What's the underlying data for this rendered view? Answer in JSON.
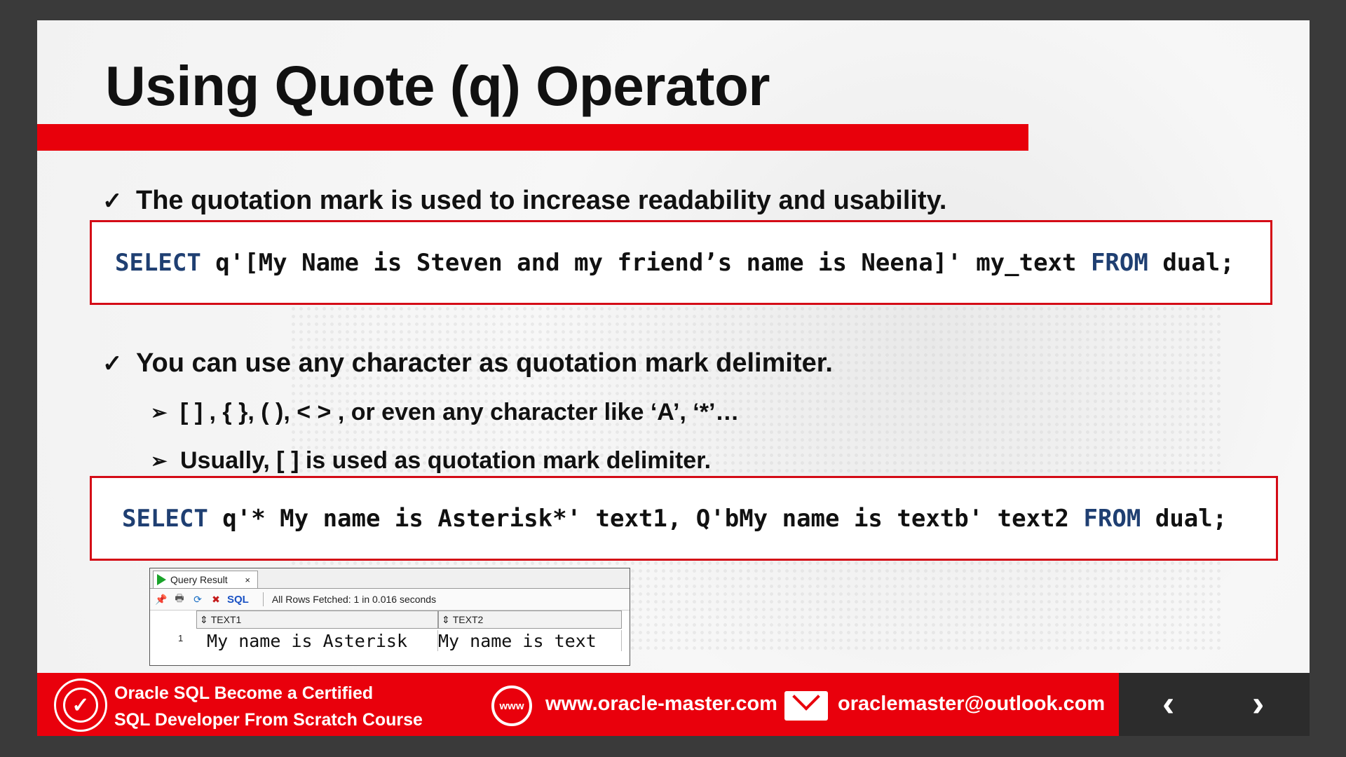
{
  "slide": {
    "title": "Using Quote (q) Operator",
    "bullets": [
      "The quotation mark is used to increase readability and usability.",
      "You can use any character as quotation mark delimiter."
    ],
    "sub_bullets": [
      "[ ] , { }, ( ), <  > , or even any character like ‘A’, ‘*’…",
      "Usually, [ ] is used as quotation mark delimiter."
    ],
    "code1": {
      "kw_select": "SELECT",
      "body": " q'[My Name is Steven and my friend’s name is Neena]' my_text ",
      "kw_from": "FROM",
      "tail": " dual;"
    },
    "code2": {
      "kw_select": "SELECT",
      "body": " q'* My name is Asterisk*' text1, Q'bMy name is textb' text2 ",
      "kw_from": "FROM",
      "tail": " dual;"
    }
  },
  "query_result": {
    "tab_label": "Query Result",
    "close": "×",
    "sql_label": "SQL",
    "status": "All Rows Fetched: 1 in 0.016 seconds",
    "columns": [
      "TEXT1",
      "TEXT2"
    ],
    "row_number": "1",
    "row": [
      " My name is Asterisk",
      "My name is text"
    ]
  },
  "footer": {
    "course_line1": "Oracle SQL Become a Certified",
    "course_line2": "SQL  Developer  From Scratch Course",
    "website": "www.oracle-master.com",
    "email": "oraclemaster@outlook.com",
    "www_icon_text": "www",
    "prev": "‹",
    "next": "›"
  },
  "colors": {
    "accent_red": "#e9000c",
    "keyword_blue": "#1f3f72"
  }
}
